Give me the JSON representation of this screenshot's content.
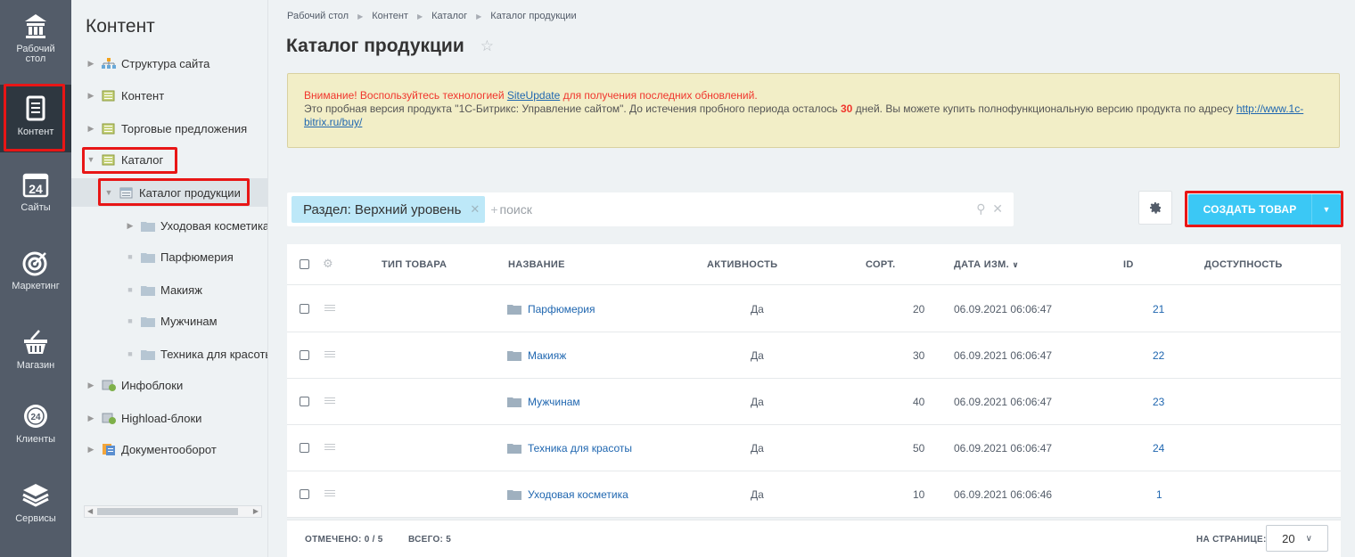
{
  "rail": [
    {
      "label": "Рабочий стол",
      "icon": "home-icon"
    },
    {
      "label": "Контент",
      "icon": "document-icon"
    },
    {
      "label": "Сайты",
      "icon": "calendar-24-icon"
    },
    {
      "label": "Маркетинг",
      "icon": "target-icon"
    },
    {
      "label": "Магазин",
      "icon": "basket-icon"
    },
    {
      "label": "Клиенты",
      "icon": "crm-24-icon"
    },
    {
      "label": "Сервисы",
      "icon": "layers-icon"
    }
  ],
  "tree": {
    "title": "Контент",
    "nodes": [
      {
        "label": "Структура сайта"
      },
      {
        "label": "Контент"
      },
      {
        "label": "Торговые предложения"
      },
      {
        "label": "Каталог"
      },
      {
        "label": "Каталог продукции"
      },
      {
        "label": "Уходовая косметика"
      },
      {
        "label": "Парфюмерия"
      },
      {
        "label": "Макияж"
      },
      {
        "label": "Мужчинам"
      },
      {
        "label": "Техника для красоты"
      },
      {
        "label": "Инфоблоки"
      },
      {
        "label": "Highload-блоки"
      },
      {
        "label": "Документооборот"
      }
    ]
  },
  "breadcrumb": [
    "Рабочий стол",
    "Контент",
    "Каталог",
    "Каталог продукции"
  ],
  "page_title": "Каталог продукции",
  "notice": {
    "warn_prefix": "Внимание! Воспользуйтесь технологией ",
    "warn_link": "SiteUpdate",
    "warn_suffix": " для получения последних обновлений.",
    "text_before": "Это пробная версия продукта \"1С-Битрикс: Управление сайтом\". До истечения пробного периода осталось ",
    "days": "30",
    "text_after": " дней. Вы можете купить полнофункциональную версию продукта по адресу ",
    "buy_link": "http://www.1c-bitrix.ru/buy/"
  },
  "filter": {
    "chip": "Раздел: Верхний уровень",
    "plus": "+",
    "placeholder": "поиск"
  },
  "create_button": "СОЗДАТЬ ТОВАР",
  "table": {
    "headers": {
      "type": "ТИП ТОВАРА",
      "name": "НАЗВАНИЕ",
      "active": "АКТИВНОСТЬ",
      "sort": "СОРТ.",
      "date": "ДАТА ИЗМ.",
      "id": "ID",
      "avail": "ДОСТУПНОСТЬ"
    },
    "rows": [
      {
        "name": "Парфюмерия",
        "active": "Да",
        "sort": "20",
        "date": "06.09.2021 06:06:47",
        "id": "21"
      },
      {
        "name": "Макияж",
        "active": "Да",
        "sort": "30",
        "date": "06.09.2021 06:06:47",
        "id": "22"
      },
      {
        "name": "Мужчинам",
        "active": "Да",
        "sort": "40",
        "date": "06.09.2021 06:06:47",
        "id": "23"
      },
      {
        "name": "Техника для красоты",
        "active": "Да",
        "sort": "50",
        "date": "06.09.2021 06:06:47",
        "id": "24"
      },
      {
        "name": "Уходовая косметика",
        "active": "Да",
        "sort": "10",
        "date": "06.09.2021 06:06:46",
        "id": "1"
      }
    ]
  },
  "footer": {
    "marked": "ОТМЕЧЕНО: 0 / 5",
    "total": "ВСЕГО: 5",
    "per_page_label": "НА СТРАНИЦЕ:",
    "per_page": "20"
  },
  "colors": {
    "accent": "#3bc8f5",
    "rail": "#535c69",
    "link": "#2067b0",
    "highlight": "#e81616"
  }
}
